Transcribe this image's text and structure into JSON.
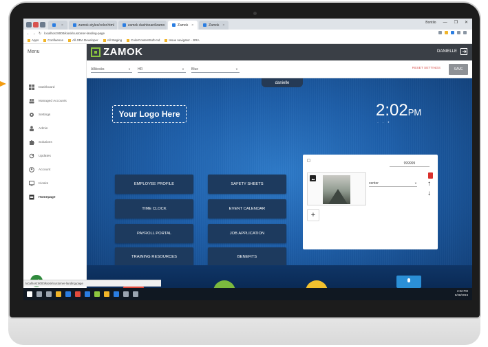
{
  "browser": {
    "tabs": [
      {
        "label": "",
        "active": false
      },
      {
        "label": "zamok-styles/color.html",
        "active": false
      },
      {
        "label": "zamok dashboard/zamo",
        "active": false
      },
      {
        "label": "Zamok",
        "active": true
      },
      {
        "label": "Zamok",
        "active": false
      }
    ],
    "window_user": "Bontilo",
    "url": "localhost:8000/kiosk/customer-landing-page",
    "bookmarks": [
      "Apps",
      "Confluence",
      "All JIRA Developer",
      "All Staging",
      "ColorContentSoft-md",
      "Issue navigator - JIRA"
    ]
  },
  "sidebar": {
    "title": "Menu",
    "items": [
      {
        "label": "Dashboard",
        "icon": "dashboard-icon"
      },
      {
        "label": "Managed Accounts",
        "icon": "users-icon"
      },
      {
        "label": "Settings",
        "icon": "gear-icon"
      },
      {
        "label": "Admin",
        "icon": "admin-icon"
      },
      {
        "label": "Solutions",
        "icon": "puzzle-icon"
      },
      {
        "label": "Updates",
        "icon": "refresh-icon"
      },
      {
        "label": "Account",
        "icon": "account-icon"
      },
      {
        "label": "Kiosks",
        "icon": "monitor-icon"
      },
      {
        "label": "Homepage",
        "icon": "homepage-icon",
        "active": true
      }
    ]
  },
  "header": {
    "brand": "ZAMOK",
    "user": "DANIELLE",
    "brand_color": "#8cc63f"
  },
  "toolbar": {
    "select_kiosk": "Allkiosks",
    "select_theme": "HR",
    "select_color": "Blue",
    "reset_label": "RESET SETTINGS",
    "save_label": "SAVE"
  },
  "preview": {
    "kiosk_name": "danielle",
    "logo_placeholder": "Your Logo Here",
    "clock_time": "2:02",
    "clock_ampm": "PM",
    "clock_dots": "· · •",
    "tiles": [
      "EMPLOYEE PROFILE",
      "SAFETY SHEETS",
      "TIME CLOCK",
      "EVENT CALENDAR",
      "PAYROLL PORTAL",
      "JOB APPLICATION",
      "TRAINING RESOURCES",
      "BENEFITS"
    ],
    "editor": {
      "color_code": "999999",
      "align_value": "center",
      "add_label": "+"
    },
    "footer_colors": [
      "#e04a3c",
      "#7bb93e",
      "#f2c12e"
    ]
  },
  "status_url": "localhost:8000/kiosk/customer-landing-page",
  "taskbar": {
    "time": "2:02 PM",
    "date": "5/28/2019"
  }
}
